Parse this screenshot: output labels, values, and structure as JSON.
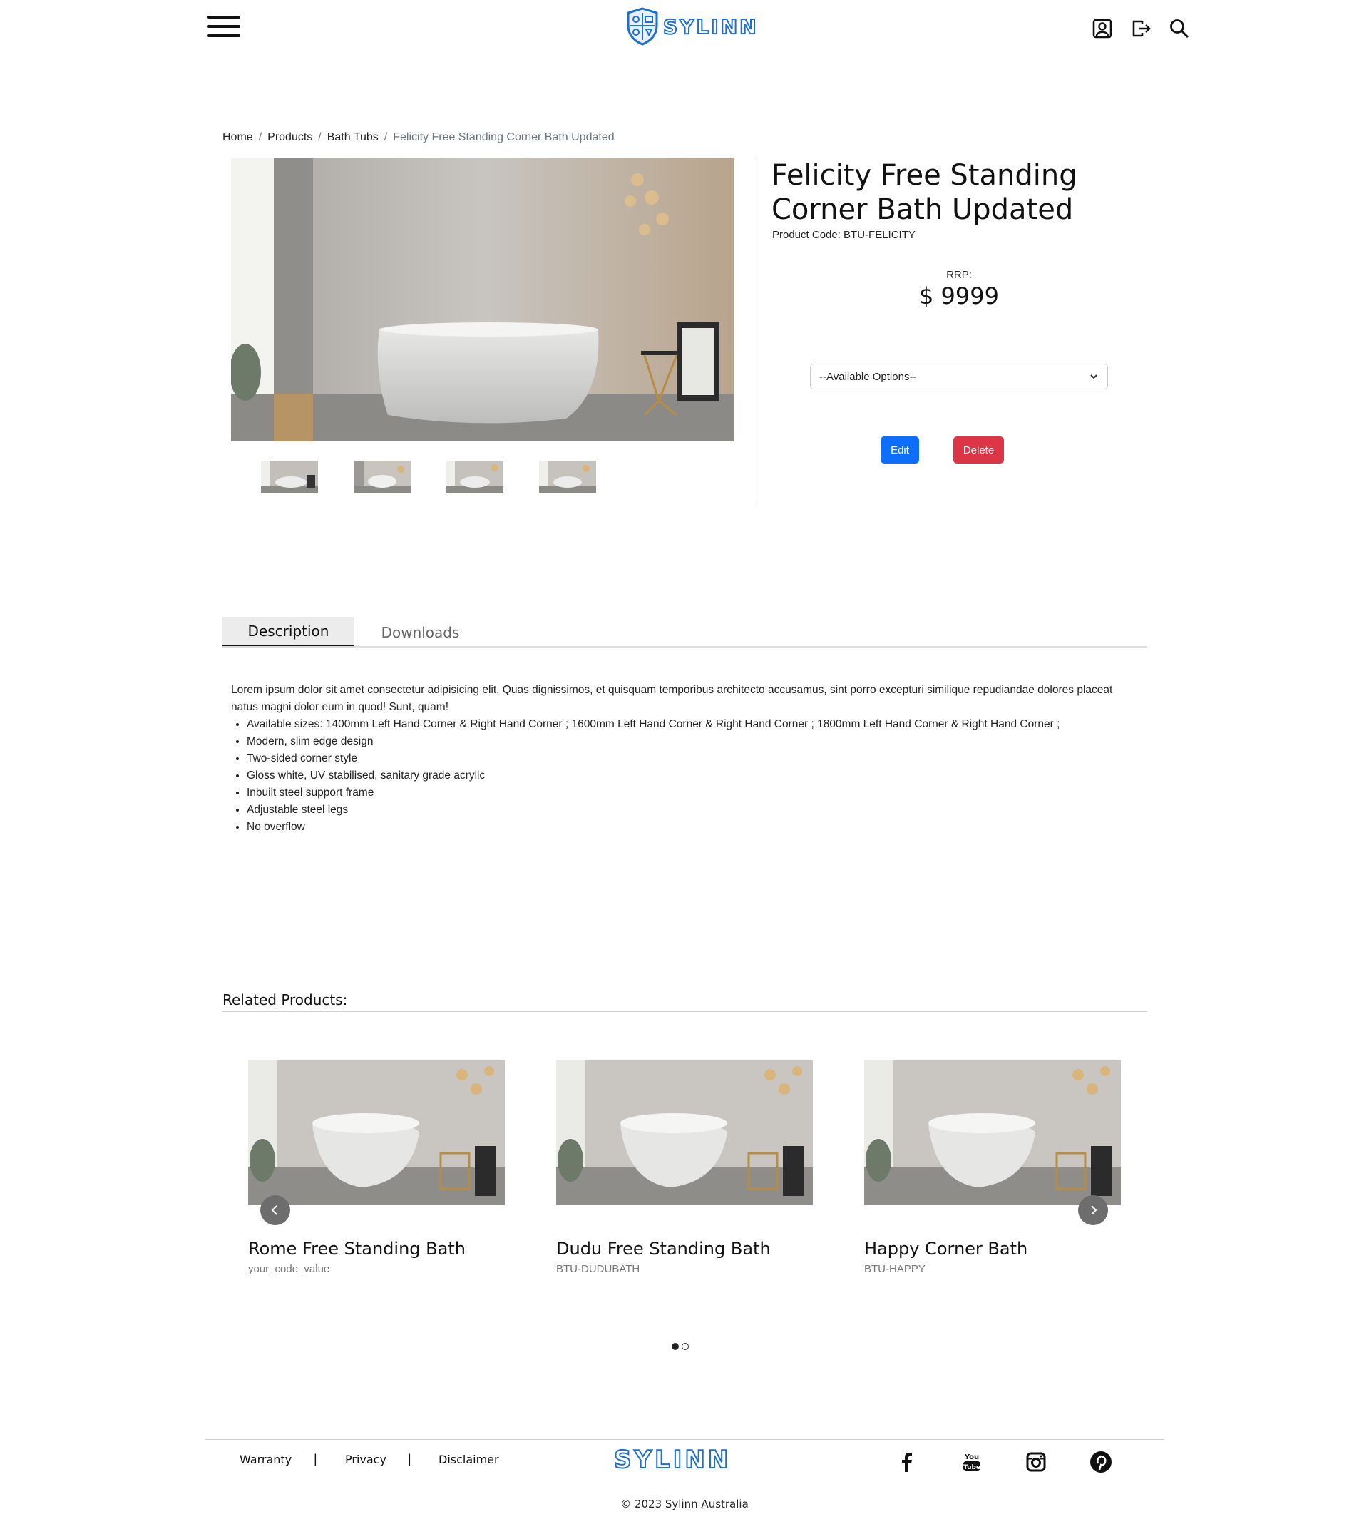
{
  "header": {
    "brand": "SYLINN",
    "icons": [
      "menu-icon",
      "account-icon",
      "logout-icon",
      "search-icon"
    ]
  },
  "breadcrumb": {
    "items": [
      "Home",
      "Products",
      "Bath Tubs"
    ],
    "current": "Felicity Free Standing Corner Bath Updated",
    "separator": "/"
  },
  "product": {
    "title": "Felicity Free Standing Corner Bath Updated",
    "code": "Product Code: BTU-FELICITY",
    "rrp_label": "RRP:",
    "price": "$ 9999",
    "options_placeholder": "--Available Options--",
    "edit_label": "Edit",
    "delete_label": "Delete"
  },
  "tabs": {
    "items": [
      "Description",
      "Downloads"
    ],
    "active": "Description"
  },
  "description": {
    "intro": "Lorem ipsum dolor sit amet consectetur adipisicing elit. Quas dignissimos, et quisquam temporibus architecto accusamus, sint porro excepturi similique repudiandae dolores placeat natus magni dolor eum in quod! Sunt, quam!",
    "features": [
      "Available sizes: 1400mm Left Hand Corner & Right Hand Corner ; 1600mm Left Hand Corner & Right Hand Corner ; 1800mm Left Hand Corner & Right Hand Corner ;",
      "Modern, slim edge design",
      "Two-sided corner style",
      "Gloss white, UV stabilised, sanitary grade acrylic",
      "Inbuilt steel support frame",
      "Adjustable steel legs",
      "No overflow"
    ]
  },
  "related": {
    "title": "Related Products:",
    "products": [
      {
        "name": "Rome Free Standing Bath",
        "code": "your_code_value"
      },
      {
        "name": "Dudu Free Standing Bath",
        "code": "BTU-DUDUBATH"
      },
      {
        "name": "Happy Corner Bath",
        "code": "BTU-HAPPY"
      }
    ],
    "pages": 2,
    "active_page": 1
  },
  "footer": {
    "links": [
      "Warranty",
      "Privacy",
      "Disclaimer"
    ],
    "separator": "|",
    "brand": "SYLINN",
    "social": [
      "facebook-icon",
      "youtube-icon",
      "instagram-icon",
      "pinterest-icon"
    ],
    "copyright": "© 2023 Sylinn Australia"
  },
  "colors": {
    "brand_blue": "#1d6fd0",
    "edit_button": "#0d6efd",
    "delete_button": "#dc3545"
  }
}
